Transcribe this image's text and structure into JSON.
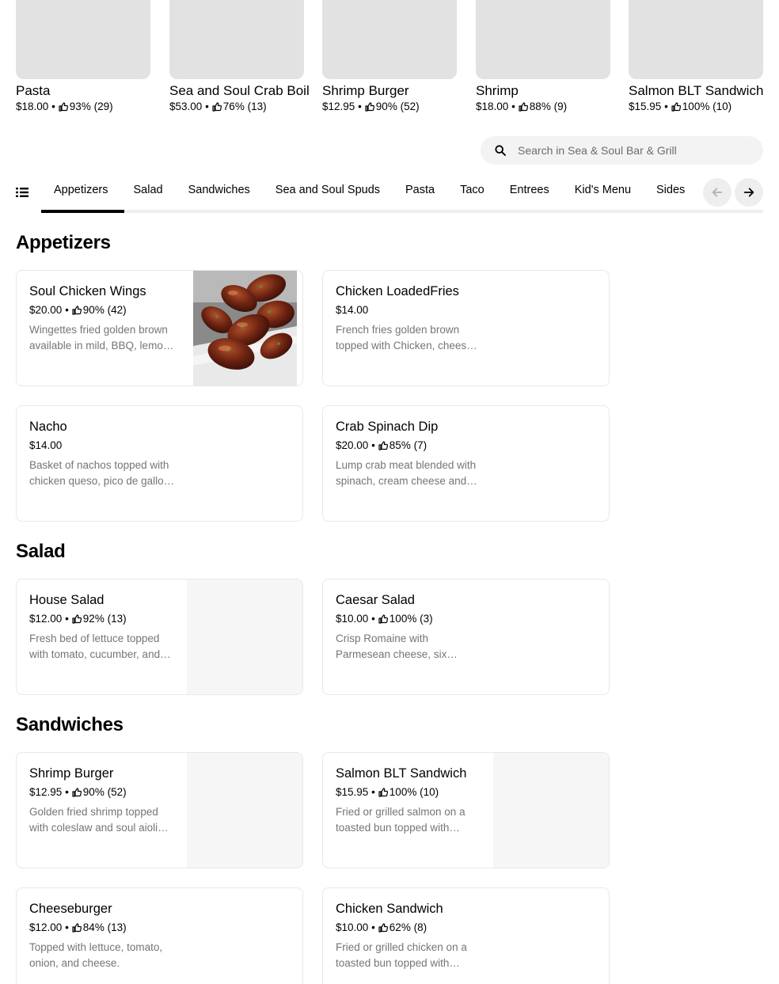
{
  "featured": [
    {
      "name": "Pasta",
      "price": "$18.00",
      "rating": "93% (29)"
    },
    {
      "name": "Sea and Soul Crab Boil",
      "price": "$53.00",
      "rating": "76% (13)"
    },
    {
      "name": "Shrimp Burger",
      "price": "$12.95",
      "rating": "90% (52)"
    },
    {
      "name": "Shrimp",
      "price": "$18.00",
      "rating": "88% (9)"
    },
    {
      "name": "Salmon BLT Sandwich",
      "price": "$15.95",
      "rating": "100% (10)"
    }
  ],
  "separator": "•",
  "search": {
    "placeholder": "Search in Sea & Soul Bar & Grill",
    "icon": "search-icon"
  },
  "tabs": [
    "Appetizers",
    "Salad",
    "Sandwiches",
    "Sea and Soul Spuds",
    "Pasta",
    "Taco",
    "Entrees",
    "Kid's Menu",
    "Sides"
  ],
  "active_tab": "Appetizers",
  "sections": {
    "appetizers": {
      "title": "Appetizers",
      "items": [
        {
          "name": "Soul Chicken Wings",
          "price": "$20.00",
          "rating": "90% (42)",
          "desc": "Wingettes fried golden brown available in mild, BBQ, lemon pepper or hot."
        },
        {
          "name": "Chicken LoadedFries",
          "price": "$14.00",
          "rating": "",
          "desc": "French fries golden brown topped with Chicken, cheese sauce and more."
        },
        {
          "name": "Nacho",
          "price": "$14.00",
          "rating": "",
          "desc": "Basket of nachos topped with chicken queso, pico de gallo and sour cream."
        },
        {
          "name": "Crab Spinach Dip",
          "price": "$20.00",
          "rating": "85% (7)",
          "desc": "Lump crab meat blended with spinach, cream cheese and spices."
        }
      ]
    },
    "salad": {
      "title": "Salad",
      "items": [
        {
          "name": "House Salad",
          "price": "$12.00",
          "rating": "92% (13)",
          "desc": "Fresh bed of lettuce topped with tomato, cucumber, and croutons."
        },
        {
          "name": "Caesar Salad",
          "price": "$10.00",
          "rating": "100% (3)",
          "desc": "Crisp Romaine with Parmesean cheese, six croutons and dressing."
        }
      ]
    },
    "sandwiches": {
      "title": "Sandwiches",
      "items": [
        {
          "name": "Shrimp Burger",
          "price": "$12.95",
          "rating": "90% (52)",
          "desc": "Golden fried shrimp topped with coleslaw and soul aioli sauce."
        },
        {
          "name": "Salmon BLT Sandwich",
          "price": "$15.95",
          "rating": "100% (10)",
          "desc": "Fried or grilled salmon on a toasted bun topped with bacon, lettuce and tomato."
        },
        {
          "name": "Cheeseburger",
          "price": "$12.00",
          "rating": "84% (13)",
          "desc": "Topped with lettuce, tomato, onion, and cheese."
        },
        {
          "name": "Chicken Sandwich",
          "price": "$10.00",
          "rating": "62% (8)",
          "desc": "Fried or grilled chicken on a toasted bun topped with lettuce and tomato."
        }
      ]
    }
  }
}
